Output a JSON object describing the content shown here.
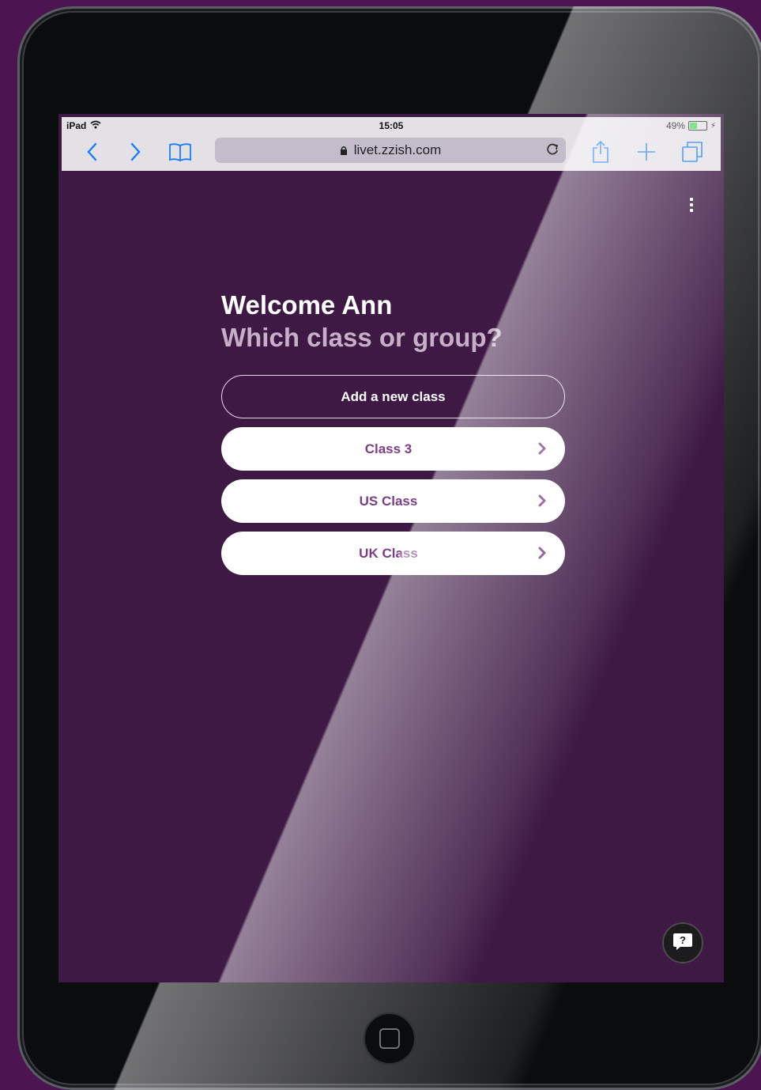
{
  "status_bar": {
    "device": "iPad",
    "time": "15:05",
    "battery": "49%",
    "battery_level": 0.49
  },
  "browser": {
    "url": "livet.zzish.com",
    "icons": [
      "back-icon",
      "forward-icon",
      "bookmarks-icon",
      "lock-icon",
      "reload-icon",
      "share-icon",
      "new-tab-icon",
      "tabs-icon"
    ]
  },
  "page": {
    "greeting": "Welcome Ann",
    "question": "Which class or group?",
    "add_class_label": "Add a new class",
    "classes": [
      {
        "label": "Class 3"
      },
      {
        "label": "US Class"
      },
      {
        "label": "UK Class"
      }
    ],
    "help_icon": "question-chat-icon",
    "menu_icon": "more-vertical-icon"
  },
  "colors": {
    "background": "#3d1944",
    "accent_text": "#7d3d86",
    "subtitle": "#c7aec9",
    "link_blue": "#1a7cf5"
  }
}
